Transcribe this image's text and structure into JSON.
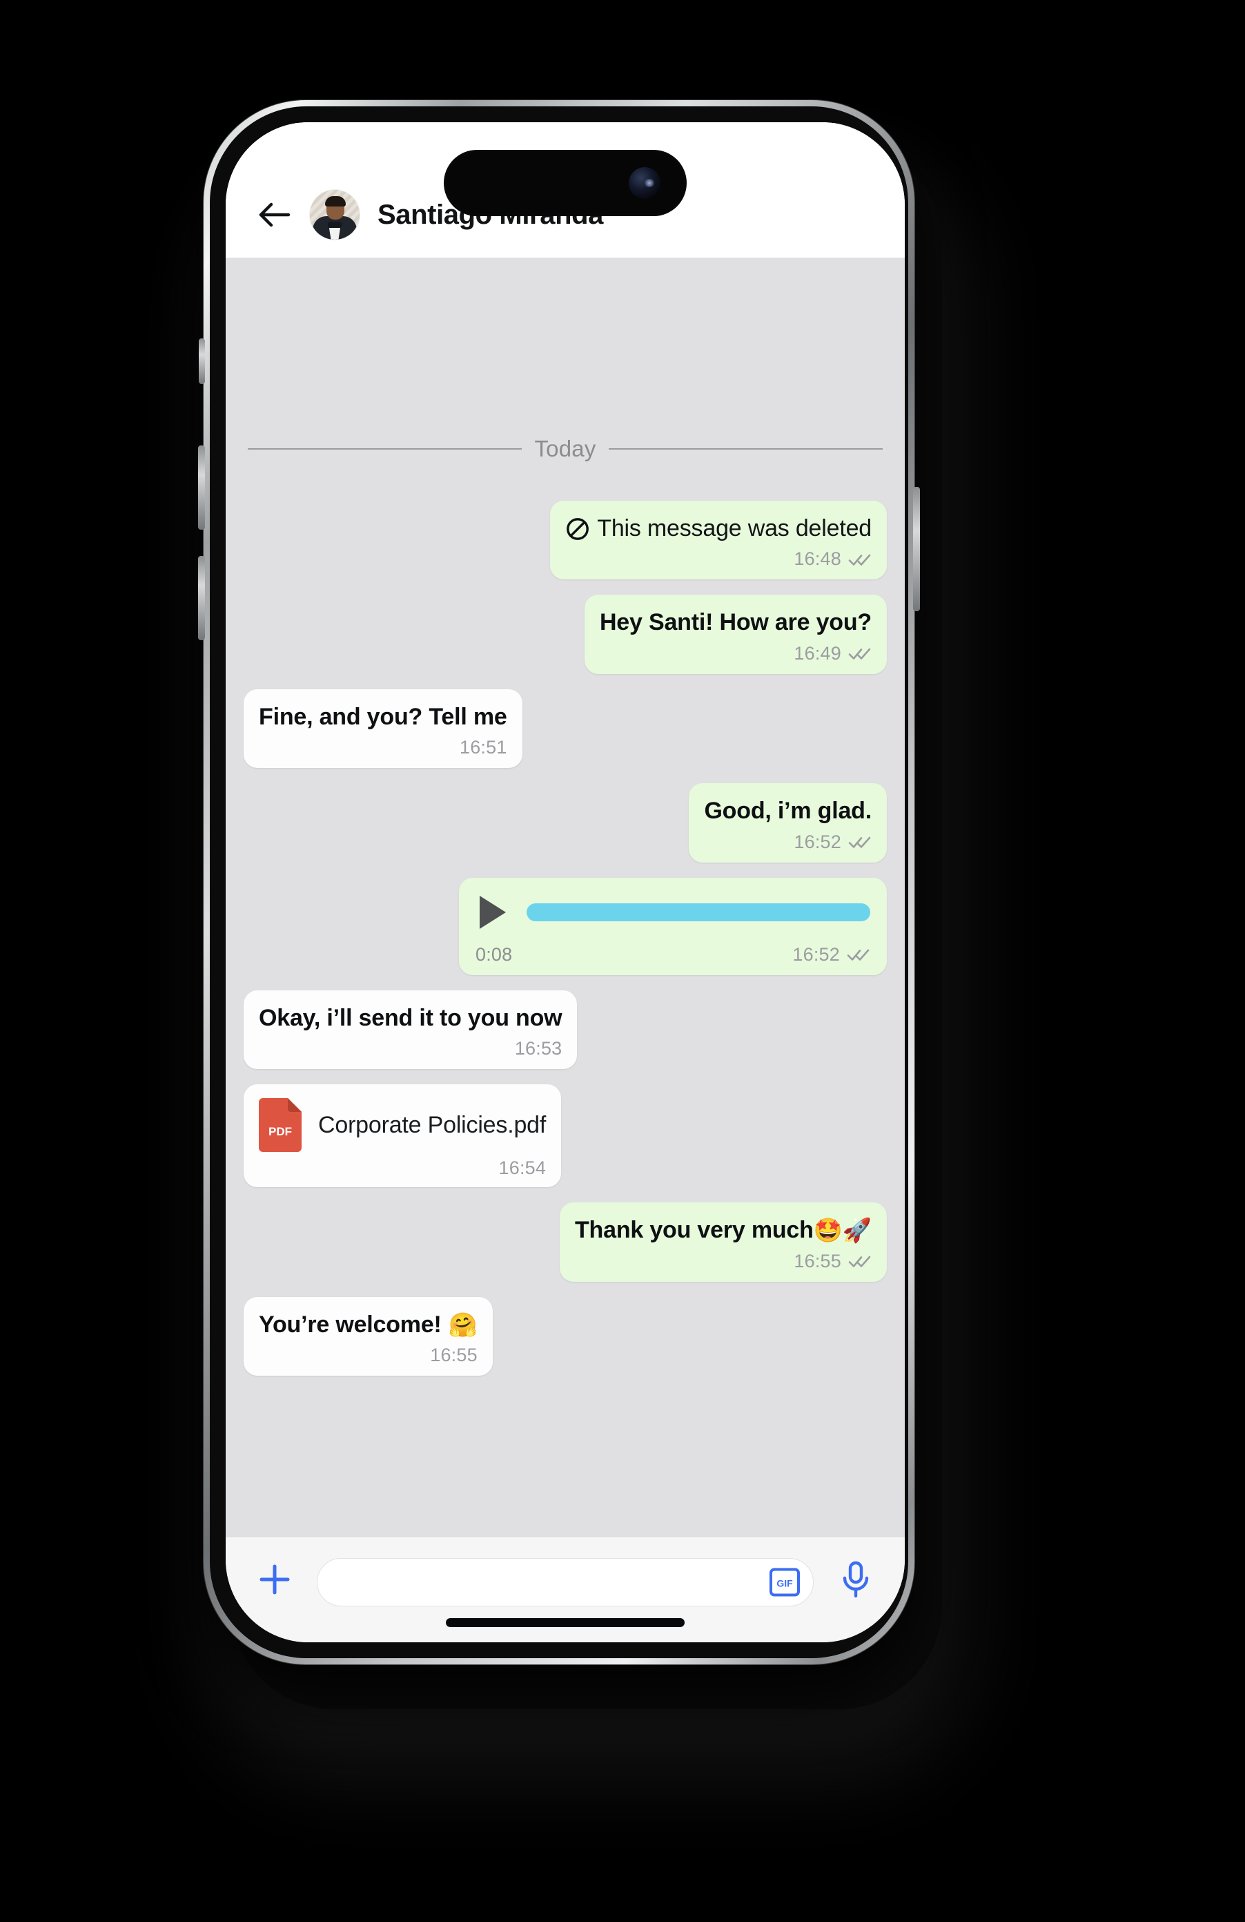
{
  "app": {
    "header": {
      "back_icon": "back-arrow-icon",
      "avatar": "contact-avatar",
      "contact_name": "Santiago Miranda"
    },
    "chat": {
      "day_divider": "Today",
      "messages": [
        {
          "id": "m1",
          "kind": "deleted",
          "side": "out",
          "icon": "prohibition-icon",
          "text": "This message was deleted",
          "time": "16:48",
          "status": "read-ticks"
        },
        {
          "id": "m2",
          "kind": "text",
          "side": "out",
          "text": "Hey Santi! How are you?",
          "time": "16:49",
          "status": "read-ticks"
        },
        {
          "id": "m3",
          "kind": "text",
          "side": "in",
          "text": "Fine, and you? Tell me",
          "time": "16:51",
          "status": ""
        },
        {
          "id": "m4",
          "kind": "text",
          "side": "out",
          "text": "Good, i’m glad.",
          "time": "16:52",
          "status": "read-ticks"
        },
        {
          "id": "m5",
          "kind": "voice",
          "side": "out",
          "play_icon": "play-icon",
          "duration": "0:08",
          "time": "16:52",
          "status": "read-ticks",
          "waveform_color": "#6cd3ec"
        },
        {
          "id": "m6",
          "kind": "text",
          "side": "in",
          "text": "Okay, i’ll send it to you now",
          "time": "16:53",
          "status": ""
        },
        {
          "id": "m7",
          "kind": "document",
          "side": "in",
          "file_icon": "pdf-file-icon",
          "file_icon_label": "PDF",
          "file_name": "Corporate Policies.pdf",
          "time": "16:54",
          "status": ""
        },
        {
          "id": "m8",
          "kind": "text",
          "side": "out",
          "text": "Thank you very much",
          "emoji": "🤩🚀",
          "time": "16:55",
          "status": "read-ticks"
        },
        {
          "id": "m9",
          "kind": "text",
          "side": "in",
          "text": "You’re welcome!",
          "emoji": "🤗",
          "time": "16:55",
          "status": ""
        }
      ]
    },
    "input_bar": {
      "plus_icon": "plus-icon",
      "message_placeholder": "",
      "message_value": "",
      "gif_icon": "gif-icon",
      "gif_label": "GIF",
      "mic_icon": "microphone-icon"
    }
  },
  "colors": {
    "outgoing_bubble": "#e7fadc",
    "incoming_bubble": "#fdfdfd",
    "chat_background": "#e0e0e2",
    "accent_blue": "#3b6ef0",
    "pdf_red": "#dd5541",
    "tick_gray": "#9c9ca1",
    "waveform_blue": "#6cd3ec"
  }
}
